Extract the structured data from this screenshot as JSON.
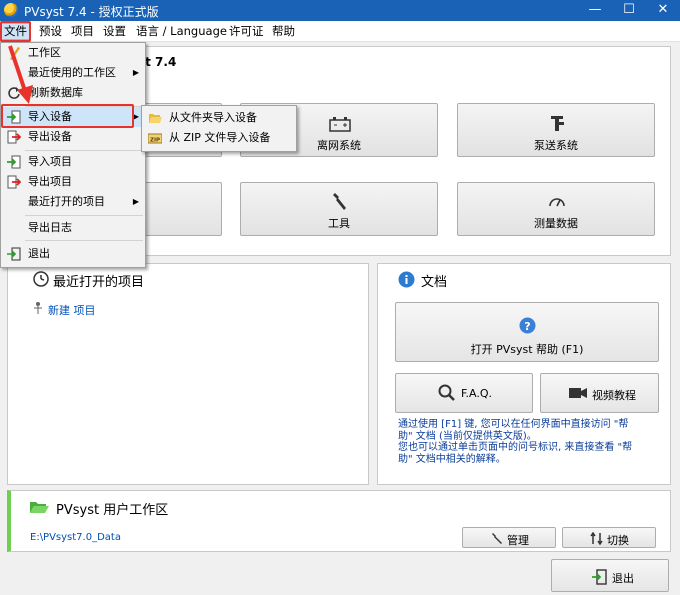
{
  "window": {
    "title": "PVsyst 7.4 - 授权正式版",
    "minimize": "—",
    "maximize": "☐",
    "close": "✕"
  },
  "menubar": {
    "items": [
      "文件",
      "预设",
      "项目",
      "设置",
      "语言 / Language",
      "许可证",
      "帮助"
    ]
  },
  "main": {
    "heading_fragment": "st 7.4",
    "buttons": {
      "offgrid": "离网系统",
      "pumping": "泵送系统",
      "tools": "工具",
      "measured": "测量数据"
    }
  },
  "recent": {
    "title": "最近打开的项目",
    "new_project": "新建 项目"
  },
  "docs": {
    "title": "文档",
    "help_button": "打开 PVsyst 帮助 (F1)",
    "faq_button": "F.A.Q.",
    "video_button": "视频教程",
    "hint_line1": "通过使用 [F1] 键, 您可以在任何界面中直接访问 \"帮",
    "hint_line2": "助\" 文档 (当前仅提供英文版)。",
    "hint_line3": "您也可以通过单击页面中的问号标识, 来直接查看 \"帮",
    "hint_line4": "助\" 文档中相关的解释。"
  },
  "workspace": {
    "title": "PVsyst 用户工作区",
    "path": "E:\\PVsyst7.0_Data",
    "manage_button": "管理",
    "switch_button": "切换"
  },
  "exit_button": "退出",
  "file_menu": {
    "items": {
      "workspace": "工作区",
      "recent_workspace": "最近使用的工作区",
      "refresh_db": "刷新数据库",
      "import_device": "导入设备",
      "export_device": "导出设备",
      "import_project": "导入项目",
      "export_project": "导出项目",
      "recent_projects": "最近打开的项目",
      "export_log": "导出日志",
      "exit": "退出"
    }
  },
  "import_submenu": {
    "from_folder": "从文件夹导入设备",
    "from_zip": "从 ZIP 文件导入设备",
    "zip_tag": "ZIP"
  },
  "colors": {
    "titlebar": "#1a62b6",
    "highlight": "#cde4f9",
    "annotation": "#e8322d",
    "link": "#0050b8",
    "accent_green": "#6fcf52"
  }
}
